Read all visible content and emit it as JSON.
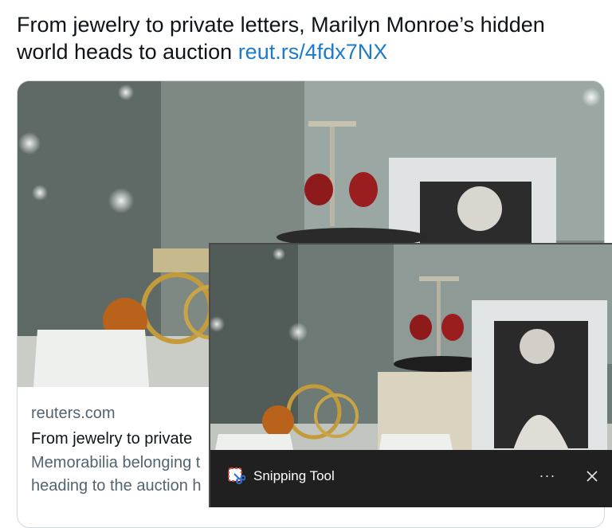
{
  "tweet": {
    "text": "From jewelry to private letters, Marilyn Monroe’s hidden world heads to auction ",
    "link": "reut.rs/4fdx7NX"
  },
  "card": {
    "domain": "reuters.com",
    "title": "From jewelry to private ",
    "description_line1": "Memorabilia belonging t",
    "description_line2": "heading to the auction h",
    "image_icon": "photo-jewelry-display"
  },
  "snipping_tool": {
    "title": "Snipping Tool",
    "more_label": "···",
    "icon": "snipping-tool-icon",
    "close_icon": "close-icon"
  }
}
